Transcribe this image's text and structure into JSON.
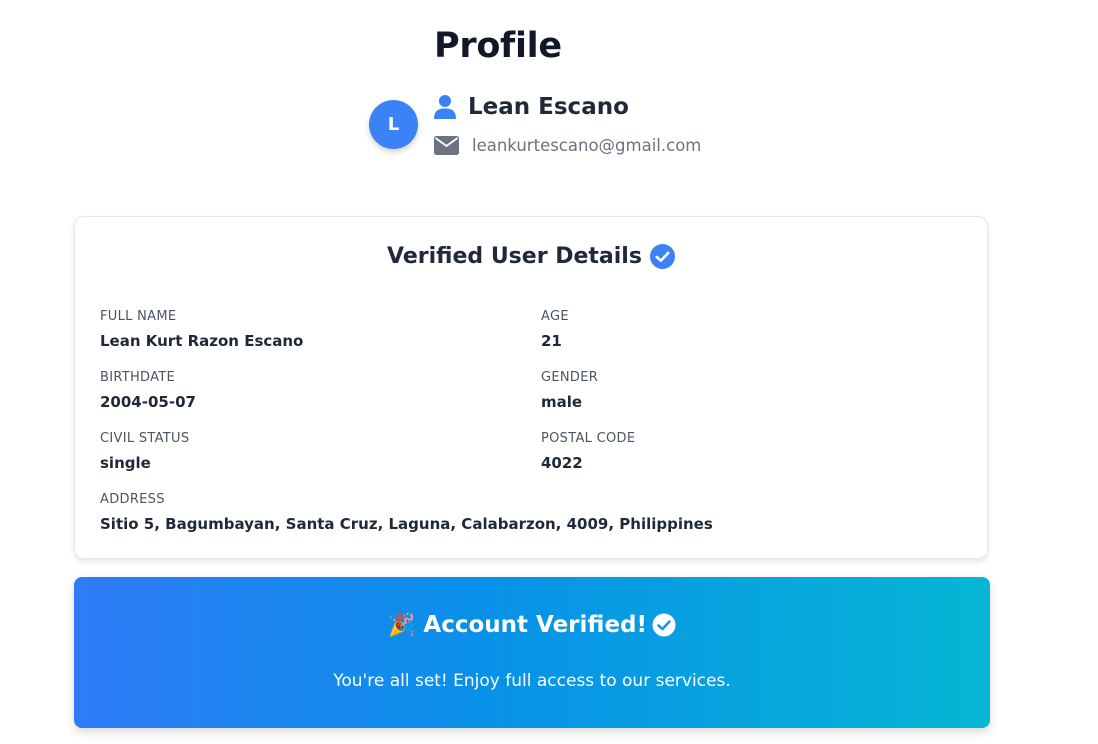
{
  "profile": {
    "title": "Profile",
    "avatar_initial": "L",
    "name": "Lean Escano",
    "email": "leankurtescano@gmail.com"
  },
  "details": {
    "title": "Verified User Details",
    "fields": [
      {
        "label": "FULL NAME",
        "value": "Lean Kurt Razon Escano"
      },
      {
        "label": "AGE",
        "value": "21"
      },
      {
        "label": "BIRTHDATE",
        "value": "2004-05-07"
      },
      {
        "label": "GENDER",
        "value": "male"
      },
      {
        "label": "CIVIL STATUS",
        "value": "single"
      },
      {
        "label": "POSTAL CODE",
        "value": "4022"
      },
      {
        "label": "ADDRESS",
        "value": "Sitio 5, Bagumbayan, Santa Cruz, Laguna, Calabarzon, 4009, Philippines"
      }
    ]
  },
  "banner": {
    "emoji": "🎉",
    "title": "Account Verified!",
    "message": "You're all set! Enjoy full access to our services."
  },
  "colors": {
    "accent": "#3b82f6",
    "banner_start": "#2f7bf6",
    "banner_end": "#06b6d4"
  },
  "icons": {
    "name": "user-icon",
    "email": "envelope-icon",
    "verified": "check-circle-icon"
  }
}
